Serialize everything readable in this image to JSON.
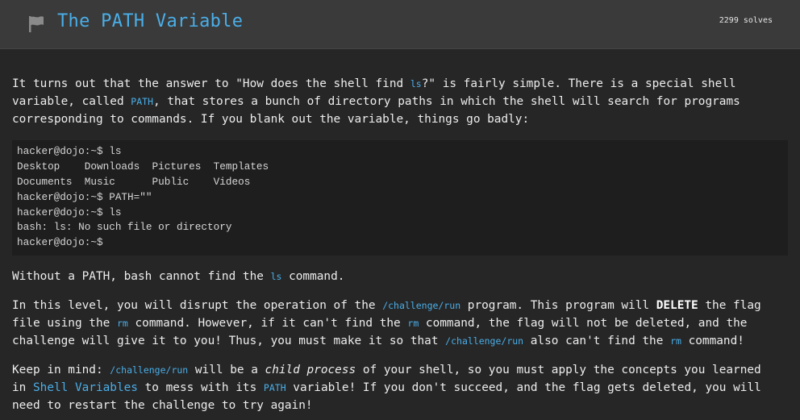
{
  "header": {
    "flag_icon": "flag-icon",
    "title": "The PATH Variable",
    "solves": "2299 solves"
  },
  "p1": {
    "t1": "It turns out that the answer to \"How does the shell find ",
    "c1": "ls",
    "t2": "?\" is fairly simple. There is a special shell",
    "t3": "variable, called ",
    "c2": "PATH",
    "t4": ", that stores a bunch of directory paths in which the shell will search for programs",
    "t5": "corresponding to commands. If you blank out the variable, things go badly:"
  },
  "terminal": {
    "lines": [
      "hacker@dojo:~$ ls",
      "Desktop    Downloads  Pictures  Templates",
      "Documents  Music      Public    Videos",
      "hacker@dojo:~$ PATH=\"\"",
      "hacker@dojo:~$ ls",
      "bash: ls: No such file or directory",
      "hacker@dojo:~$"
    ]
  },
  "p2": {
    "t1": "Without a PATH, bash cannot find the ",
    "c1": "ls",
    "t2": " command."
  },
  "p3": {
    "t1": "In this level, you will disrupt the operation of the ",
    "c1": "/challenge/run",
    "t2": " program. This program will ",
    "b1": "DELETE",
    "t3": " the flag",
    "t4": "file using the ",
    "c2": "rm",
    "t5": " command. However, if it can't find the ",
    "c3": "rm",
    "t6": " command, the flag will not be deleted, and the",
    "t7": "challenge will give it to you! Thus, you must make it so that ",
    "c4": "/challenge/run",
    "t8": " also can't find the ",
    "c5": "rm",
    "t9": " command!"
  },
  "p4": {
    "t1": "Keep in mind: ",
    "c1": "/challenge/run",
    "t2": " will be a ",
    "i1": "child process",
    "t3": " of your shell, so you must apply the concepts you learned",
    "t4": "in ",
    "a1": "Shell Variables",
    "t5": " to mess with its ",
    "c2": "PATH",
    "t6": " variable! If you don't succeed, and the flag gets deleted, you will",
    "t7": "need to restart the challenge to try again!"
  }
}
